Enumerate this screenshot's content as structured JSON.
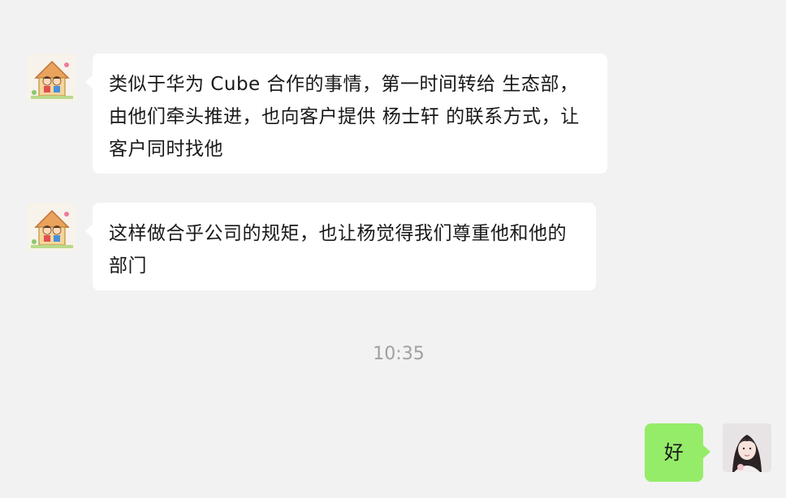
{
  "messages": [
    {
      "sender": "other",
      "avatar": "cartoon-house-avatar-icon",
      "text": "类似于华为 Cube 合作的事情，第一时间转给 生态部，由他们牵头推进，也向客户提供 杨士轩 的联系方式，让客户同时找他"
    },
    {
      "sender": "other",
      "avatar": "cartoon-house-avatar-icon",
      "text": "这样做合乎公司的规矩，也让杨觉得我们尊重他和他的部门"
    },
    {
      "sender": "me",
      "avatar": "woman-photo-avatar-icon",
      "text": "好"
    }
  ],
  "timestamp": "10:35",
  "colors": {
    "background": "#f2f2f2",
    "incoming_bubble": "#ffffff",
    "outgoing_bubble": "#95ec69",
    "timestamp": "#a0a0a0"
  }
}
